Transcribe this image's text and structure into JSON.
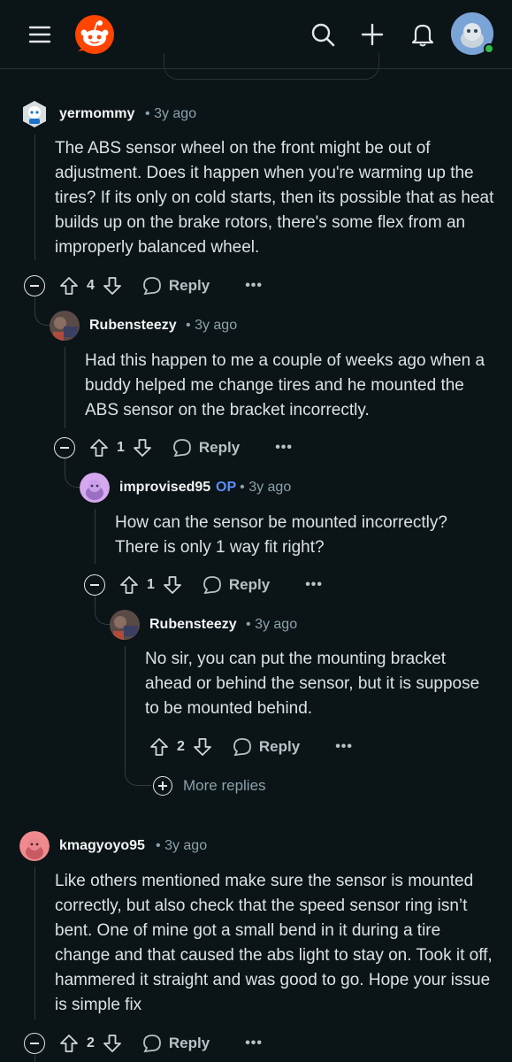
{
  "header": {
    "icons": [
      "menu-icon",
      "reddit-logo",
      "search-icon",
      "plus-icon",
      "bell-icon",
      "user-avatar"
    ]
  },
  "comments": [
    {
      "author": "yermommy",
      "meta": "3y ago",
      "body": "The ABS sensor wheel on the front might be out of adjustment. Does it happen when you're warming up the tires? If its only on cold starts, then its possible that as heat builds up on the brake rotors, there's some flex from an improperly balanced wheel.",
      "votes": "4",
      "reply": "Reply",
      "more": "•••"
    },
    {
      "author": "Rubensteezy",
      "meta": "3y ago",
      "body": "Had this happen to me a couple of weeks ago when a buddy helped me change tires and he mounted the ABS sensor on the bracket incorrectly.",
      "votes": "1",
      "reply": "Reply",
      "more": "•••"
    },
    {
      "author": "improvised95",
      "op": "OP",
      "meta": "3y ago",
      "body": "How can the sensor be mounted incorrectly? There is only 1 way fit right?",
      "votes": "1",
      "reply": "Reply",
      "more": "•••"
    },
    {
      "author": "Rubensteezy",
      "meta": "3y ago",
      "body": "No sir, you can put the mounting bracket ahead or behind the sensor, but it is suppose to be mounted behind.",
      "votes": "2",
      "reply": "Reply",
      "more": "•••"
    },
    {
      "author": "kmagyoyo95",
      "meta": "3y ago",
      "body": "Like others mentioned make sure the sensor is mounted correctly, but also check that the speed sensor ring isn’t bent. One of mine got a small bend in it during a tire change and that caused the abs light to stay on. Took it off, hammered it straight and was good to go. Hope your issue is simple fix",
      "votes": "2",
      "reply": "Reply",
      "more": "•••"
    }
  ],
  "more_replies": "More replies",
  "separator": "•",
  "colors": {
    "background": "#0b1416",
    "op_badge": "#5a8dff",
    "reddit_orange": "#ff4500",
    "online": "#2fbf4a"
  }
}
